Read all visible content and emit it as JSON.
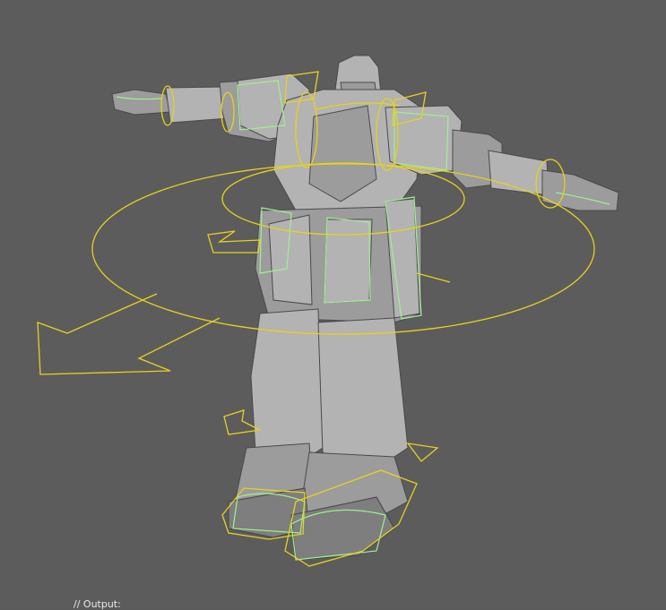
{
  "viewport": {
    "background": "#5c5c5c",
    "status_text": "// Output:"
  },
  "scene": {
    "model": "robot-mech-t-pose",
    "controller_color": "#e6d21e",
    "selected_color": "#9ff08f",
    "mesh_color": "#9c9c9c"
  }
}
